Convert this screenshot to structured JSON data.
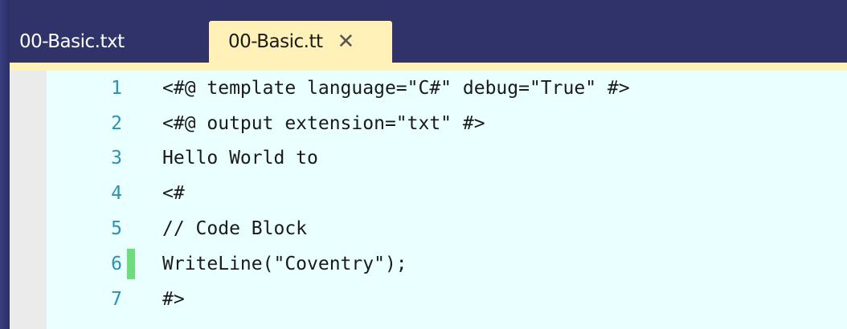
{
  "tabs": [
    {
      "label": "00-Basic.txt",
      "active": false
    },
    {
      "label": "00-Basic.tt",
      "active": true,
      "close_icon": "close-icon"
    }
  ],
  "editor": {
    "lines": [
      {
        "number": "1",
        "text": "<#@ template language=\"C#\" debug=\"True\" #>",
        "changed": false
      },
      {
        "number": "2",
        "text": "<#@ output extension=\"txt\" #>",
        "changed": false
      },
      {
        "number": "3",
        "text": "Hello World to",
        "changed": false
      },
      {
        "number": "4",
        "text": "<#",
        "changed": false
      },
      {
        "number": "5",
        "text": "// Code Block",
        "changed": false
      },
      {
        "number": "6",
        "text": "WriteLine(\"Coventry\");",
        "changed": true
      },
      {
        "number": "7",
        "text": "#>",
        "changed": false
      }
    ]
  },
  "colors": {
    "frame": "#2f3369",
    "active_tab": "#fff1b8",
    "editor_bg": "#eaffff",
    "line_number": "#2b91af",
    "change_marker": "#6cdc7c"
  }
}
